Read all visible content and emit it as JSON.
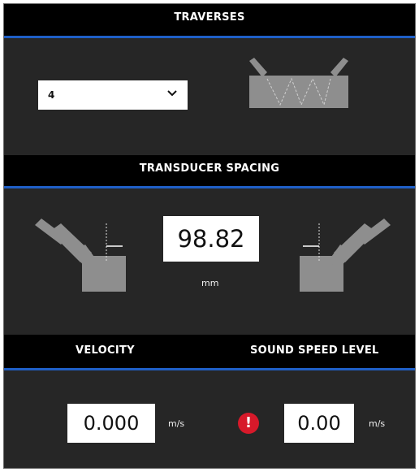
{
  "traverses": {
    "title": "TRAVERSES",
    "selected": "4"
  },
  "transducer_spacing": {
    "title": "TRANSDUCER SPACING",
    "value": "98.82",
    "unit": "mm"
  },
  "velocity": {
    "title": "VELOCITY",
    "value": "0.000",
    "unit": "m/s"
  },
  "sound_speed_level": {
    "title": "SOUND SPEED LEVEL",
    "value": "0.00",
    "unit": "m/s"
  },
  "icons": {
    "dropdown": "chevron-down-icon",
    "alert": "exclamation-alert-icon"
  },
  "colors": {
    "panel_bg": "#262626",
    "header_bg": "#000000",
    "accent_blue": "#1f5fc7",
    "alert_red": "#d7192a",
    "graphic_gray": "#8e8e8e"
  }
}
